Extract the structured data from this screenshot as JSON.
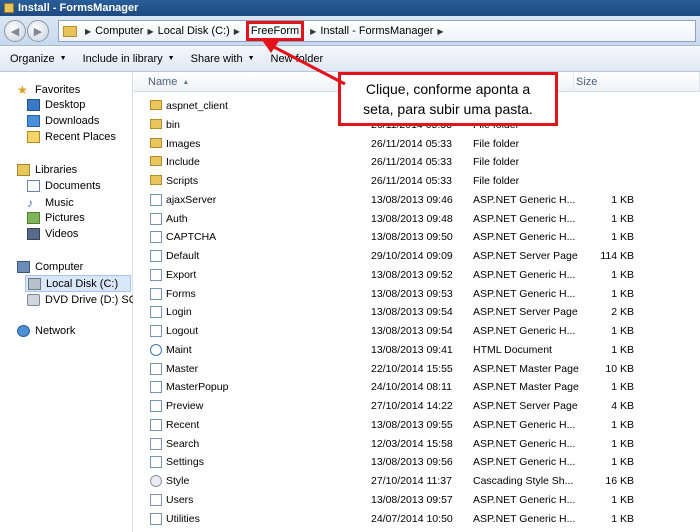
{
  "window": {
    "title": "Install - FormsManager"
  },
  "address": {
    "crumbs": [
      "Computer",
      "Local Disk (C:)",
      "FreeForm",
      "Install - FormsManager"
    ]
  },
  "toolbar": {
    "organize": "Organize",
    "include_in_library": "Include in library",
    "share_with": "Share with",
    "new_folder": "New folder"
  },
  "nav": {
    "favorites": "Favorites",
    "desktop": "Desktop",
    "downloads": "Downloads",
    "recent_places": "Recent Places",
    "libraries": "Libraries",
    "documents": "Documents",
    "music": "Music",
    "pictures": "Pictures",
    "videos": "Videos",
    "computer": "Computer",
    "local_disk": "Local Disk (C:)",
    "dvd_drive": "DVD Drive (D:) SQLFUI",
    "network": "Network"
  },
  "columns": {
    "name": "Name",
    "size": "Size"
  },
  "callout": {
    "text": "Clique, conforme aponta a seta, para subir uma pasta."
  },
  "files": [
    {
      "name": "aspnet_client",
      "date": "",
      "type": "",
      "size": "",
      "icon": "folder"
    },
    {
      "name": "bin",
      "date": "26/11/2014 05:33",
      "type": "File folder",
      "size": "",
      "icon": "folder"
    },
    {
      "name": "Images",
      "date": "26/11/2014 05:33",
      "type": "File folder",
      "size": "",
      "icon": "folder"
    },
    {
      "name": "Include",
      "date": "26/11/2014 05:33",
      "type": "File folder",
      "size": "",
      "icon": "folder"
    },
    {
      "name": "Scripts",
      "date": "26/11/2014 05:33",
      "type": "File folder",
      "size": "",
      "icon": "folder"
    },
    {
      "name": "ajaxServer",
      "date": "13/08/2013 09:46",
      "type": "ASP.NET Generic H...",
      "size": "1 KB",
      "icon": "file"
    },
    {
      "name": "Auth",
      "date": "13/08/2013 09:48",
      "type": "ASP.NET Generic H...",
      "size": "1 KB",
      "icon": "file"
    },
    {
      "name": "CAPTCHA",
      "date": "13/08/2013 09:50",
      "type": "ASP.NET Generic H...",
      "size": "1 KB",
      "icon": "file"
    },
    {
      "name": "Default",
      "date": "29/10/2014 09:09",
      "type": "ASP.NET Server Page",
      "size": "114 KB",
      "icon": "file"
    },
    {
      "name": "Export",
      "date": "13/08/2013 09:52",
      "type": "ASP.NET Generic H...",
      "size": "1 KB",
      "icon": "file"
    },
    {
      "name": "Forms",
      "date": "13/08/2013 09:53",
      "type": "ASP.NET Generic H...",
      "size": "1 KB",
      "icon": "file"
    },
    {
      "name": "Login",
      "date": "13/08/2013 09:54",
      "type": "ASP.NET Server Page",
      "size": "2 KB",
      "icon": "file"
    },
    {
      "name": "Logout",
      "date": "13/08/2013 09:54",
      "type": "ASP.NET Generic H...",
      "size": "1 KB",
      "icon": "file"
    },
    {
      "name": "Maint",
      "date": "13/08/2013 09:41",
      "type": "HTML Document",
      "size": "1 KB",
      "icon": "html"
    },
    {
      "name": "Master",
      "date": "22/10/2014 15:55",
      "type": "ASP.NET Master Page",
      "size": "10 KB",
      "icon": "file"
    },
    {
      "name": "MasterPopup",
      "date": "24/10/2014 08:11",
      "type": "ASP.NET Master Page",
      "size": "1 KB",
      "icon": "file"
    },
    {
      "name": "Preview",
      "date": "27/10/2014 14:22",
      "type": "ASP.NET Server Page",
      "size": "4 KB",
      "icon": "file"
    },
    {
      "name": "Recent",
      "date": "13/08/2013 09:55",
      "type": "ASP.NET Generic H...",
      "size": "1 KB",
      "icon": "file"
    },
    {
      "name": "Search",
      "date": "12/03/2014 15:58",
      "type": "ASP.NET Generic H...",
      "size": "1 KB",
      "icon": "file"
    },
    {
      "name": "Settings",
      "date": "13/08/2013 09:56",
      "type": "ASP.NET Generic H...",
      "size": "1 KB",
      "icon": "file"
    },
    {
      "name": "Style",
      "date": "27/10/2014 11:37",
      "type": "Cascading Style Sh...",
      "size": "16 KB",
      "icon": "css"
    },
    {
      "name": "Users",
      "date": "13/08/2013 09:57",
      "type": "ASP.NET Generic H...",
      "size": "1 KB",
      "icon": "file"
    },
    {
      "name": "Utilities",
      "date": "24/07/2014 10:50",
      "type": "ASP.NET Generic H...",
      "size": "1 KB",
      "icon": "file"
    }
  ]
}
